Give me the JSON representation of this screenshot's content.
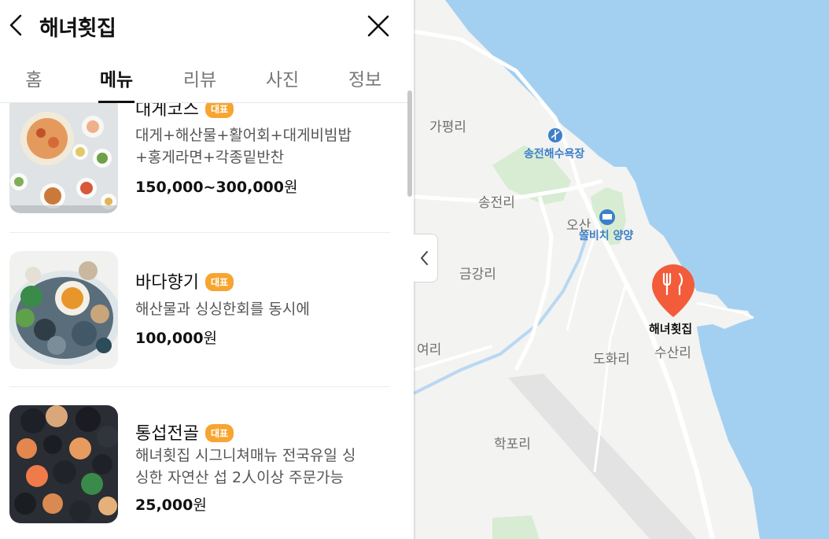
{
  "header": {
    "title": "해녀횟집"
  },
  "tabs": [
    {
      "label": "홈"
    },
    {
      "label": "메뉴"
    },
    {
      "label": "리뷰"
    },
    {
      "label": "사진"
    },
    {
      "label": "정보"
    }
  ],
  "active_tab": "메뉴",
  "menu": [
    {
      "name": "대게코스",
      "badge": "대표",
      "desc_line1": "대게+해산물+활어회+대게비빔밥",
      "desc_line2": "+홍게라면+각종밑반찬",
      "price": "150,000~300,000",
      "unit": "원"
    },
    {
      "name": "바다향기",
      "badge": "대표",
      "desc_line1": "해산물과 싱싱한회를 동시에",
      "price": "100,000",
      "unit": "원"
    },
    {
      "name": "통섭전골",
      "badge": "대표",
      "desc_line1": "해녀횟집 시그니쳐매뉴 전국유일 싱",
      "desc_line2": "싱한 자연산 섭 2人이상 주문가능",
      "price": "25,000",
      "unit": "원"
    }
  ],
  "map": {
    "labels": {
      "gapyeong": "가평리",
      "songjeon_beach": "송전해수욕장",
      "songjeon": "송전리",
      "osan": "오산",
      "solbeach": "쏠비치 양양",
      "geumgang": "금강리",
      "yeori": "여리",
      "dohwa": "도화리",
      "susan": "수산리",
      "hakpo": "학포리"
    },
    "pin_label": "해녀횟집",
    "colors": {
      "sea": "#a3d0f1",
      "land": "#f3f3f1",
      "green": "#d7ecd3",
      "pin": "#f25c3b"
    }
  }
}
